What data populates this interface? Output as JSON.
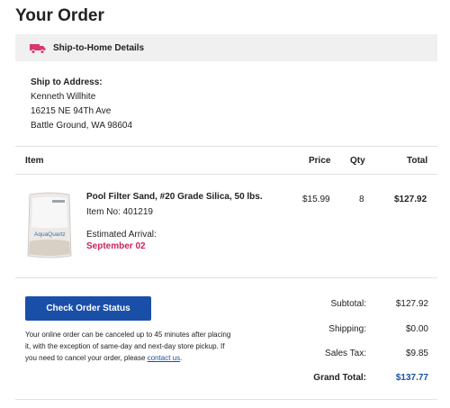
{
  "page": {
    "title": "Your Order"
  },
  "ship_banner": {
    "label": "Ship-to-Home Details",
    "icon": "truck-icon",
    "icon_color": "#d9376e"
  },
  "ship_to": {
    "header": "Ship to Address:",
    "name": "Kenneth Willhite",
    "street": "16215 NE 94Th Ave",
    "city_line": "Battle Ground, WA 98604"
  },
  "table": {
    "headers": {
      "item": "Item",
      "price": "Price",
      "qty": "Qty",
      "total": "Total"
    }
  },
  "item": {
    "name": "Pool Filter Sand, #20 Grade Silica, 50 lbs.",
    "item_no": "Item No: 401219",
    "arrival_label": "Estimated Arrival:",
    "arrival_date": "September 02",
    "price": "$15.99",
    "qty": "8",
    "total": "$127.92",
    "image_label": "AquaQuartz"
  },
  "actions": {
    "check_status_label": "Check Order Status",
    "cancel_note": "Your online order can be canceled up to 45 minutes after placing it, with the exception of same-day and next-day store pickup. If you need to cancel your order, please",
    "contact_link": "contact us",
    "cancel_note_end": "."
  },
  "summary": {
    "subtotal_label": "Subtotal:",
    "subtotal": "$127.92",
    "shipping_label": "Shipping:",
    "shipping": "$0.00",
    "tax_label": "Sales Tax:",
    "tax": "$9.85",
    "grand_label": "Grand Total:",
    "grand": "$137.77"
  },
  "colors": {
    "accent_blue": "#1a4fa8",
    "arrival_pink": "#c8245c",
    "banner_bg": "#f0f0f0"
  }
}
